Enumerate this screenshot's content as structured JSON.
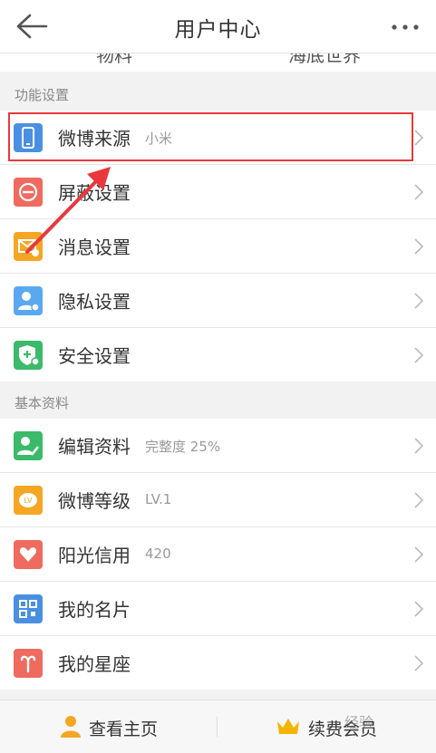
{
  "header": {
    "title": "用户中心",
    "back_icon": "arrow-left-icon",
    "more_icon": "more-dots-icon"
  },
  "peek": {
    "left_text": "物料",
    "right_text": "海底世界"
  },
  "sections": [
    {
      "title": "功能设置",
      "items": [
        {
          "label": "微博来源",
          "sub": "小米",
          "icon": "phone-icon",
          "color": "#4a90e2"
        },
        {
          "label": "屏蔽设置",
          "sub": "",
          "icon": "block-icon",
          "color": "#ef6a5f"
        },
        {
          "label": "消息设置",
          "sub": "",
          "icon": "message-icon",
          "color": "#f5a623"
        },
        {
          "label": "隐私设置",
          "sub": "",
          "icon": "privacy-icon",
          "color": "#5aa9f0"
        },
        {
          "label": "安全设置",
          "sub": "",
          "icon": "shield-icon",
          "color": "#3bba6a"
        }
      ]
    },
    {
      "title": "基本资料",
      "items": [
        {
          "label": "编辑资料",
          "sub": "完整度 25%",
          "icon": "edit-profile-icon",
          "color": "#3bba6a"
        },
        {
          "label": "微博等级",
          "sub": "LV.1",
          "icon": "level-icon",
          "color": "#f5a623"
        },
        {
          "label": "阳光信用",
          "sub": "420",
          "icon": "credit-icon",
          "color": "#ef6a5f"
        },
        {
          "label": "我的名片",
          "sub": "",
          "icon": "qr-card-icon",
          "color": "#4a90e2"
        },
        {
          "label": "我的星座",
          "sub": "",
          "icon": "zodiac-icon",
          "color": "#ef6a5f"
        }
      ]
    }
  ],
  "bottom_bar": {
    "home_label": "查看主页",
    "home_icon": "person-icon",
    "vip_label": "续费会员",
    "vip_icon": "crown-icon"
  },
  "watermark": "经验"
}
